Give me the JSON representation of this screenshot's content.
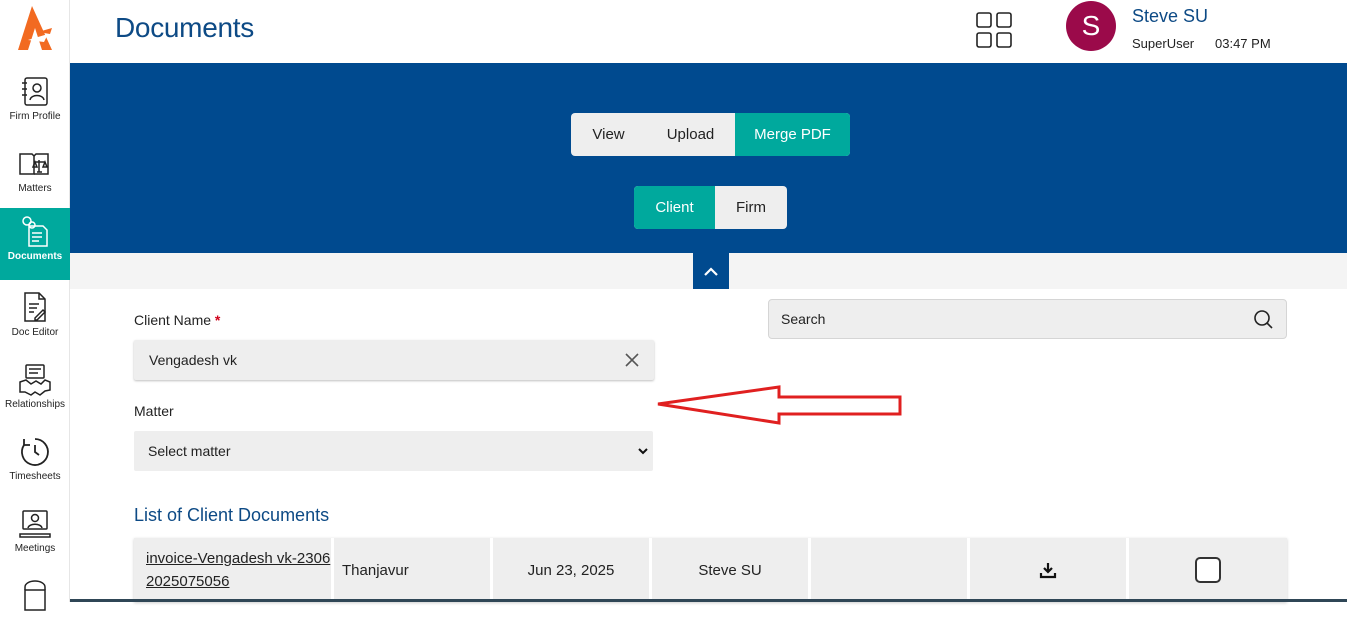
{
  "sidebar": {
    "items": [
      {
        "label": "Firm Profile",
        "icon": "firm-profile-icon"
      },
      {
        "label": "Matters",
        "icon": "matters-icon"
      },
      {
        "label": "Documents",
        "icon": "documents-icon",
        "active": true
      },
      {
        "label": "Doc Editor",
        "icon": "doc-editor-icon"
      },
      {
        "label": "Relationships",
        "icon": "relationships-icon"
      },
      {
        "label": "Timesheets",
        "icon": "timesheets-icon"
      },
      {
        "label": "Meetings",
        "icon": "meetings-icon"
      }
    ]
  },
  "header": {
    "title": "Documents",
    "user": {
      "initial": "S",
      "name": "Steve SU",
      "role": "SuperUser",
      "time": "03:47 PM"
    }
  },
  "tabs": {
    "primary": [
      "View",
      "Upload",
      "Merge PDF"
    ],
    "primary_active": "Merge PDF",
    "secondary": [
      "Client",
      "Firm"
    ],
    "secondary_active": "Client"
  },
  "form": {
    "client_label": "Client Name",
    "required_mark": "*",
    "client_value": "Vengadesh vk",
    "matter_label": "Matter",
    "matter_value": "Select matter",
    "search_placeholder": "Search"
  },
  "section_title": "List of Client Documents",
  "documents": [
    {
      "name": "invoice-Vengadesh vk-23062025075056",
      "location": "Thanjavur",
      "date": "Jun 23, 2025",
      "owner": "Steve SU",
      "extra": ""
    }
  ],
  "colors": {
    "brand_blue": "#004a8f",
    "title_blue": "#0d4a85",
    "accent_teal": "#00a99d",
    "avatar": "#9b0a4a",
    "annotation_red": "#e02020"
  }
}
